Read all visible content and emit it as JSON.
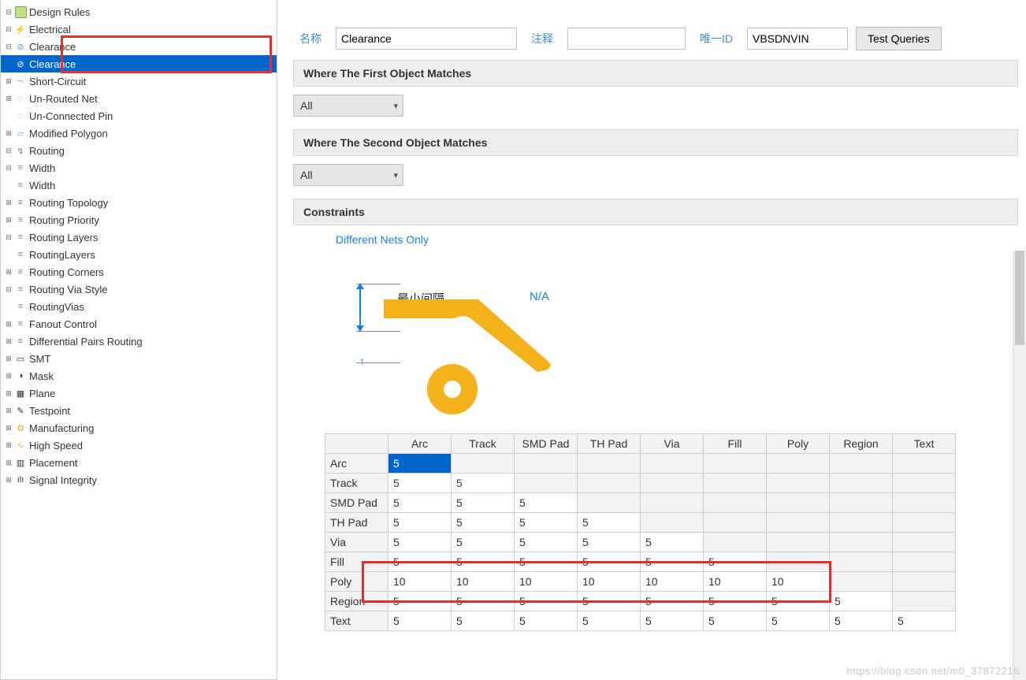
{
  "tree": {
    "root": "Design Rules",
    "electrical": {
      "label": "Electrical",
      "clearance": "Clearance",
      "clearance_child": "Clearance",
      "short_circuit": "Short-Circuit",
      "unrouted": "Un-Routed Net",
      "unconnected": "Un-Connected Pin",
      "modified_polygon": "Modified Polygon"
    },
    "routing": {
      "label": "Routing",
      "width": "Width",
      "width_child": "Width",
      "topology": "Routing Topology",
      "priority": "Routing Priority",
      "layers": "Routing Layers",
      "layers_child": "RoutingLayers",
      "corners": "Routing Corners",
      "via_style": "Routing Via Style",
      "via_child": "RoutingVias",
      "fanout": "Fanout Control",
      "diffpair": "Differential Pairs Routing"
    },
    "smt": "SMT",
    "mask": "Mask",
    "plane": "Plane",
    "testpoint": "Testpoint",
    "manufacturing": "Manufacturing",
    "highspeed": "High Speed",
    "placement": "Placement",
    "signal_integrity": "Signal Integrity"
  },
  "form": {
    "name_label": "名称",
    "name_value": "Clearance",
    "comment_label": "注释",
    "comment_value": "",
    "id_label": "唯一ID",
    "id_value": "VBSDNVIN",
    "test_btn": "Test Queries"
  },
  "sections": {
    "first_match": "Where The First Object Matches",
    "second_match": "Where The Second Object Matches",
    "first_value": "All",
    "second_value": "All",
    "constraints": "Constraints"
  },
  "constraints": {
    "diff_nets": "Different Nets Only",
    "min_gap": "最小间隔",
    "na": "N/A"
  },
  "matrix": {
    "cols": [
      "Arc",
      "Track",
      "SMD Pad",
      "TH Pad",
      "Via",
      "Fill",
      "Poly",
      "Region",
      "Text"
    ],
    "rows": [
      {
        "h": "Arc",
        "v": [
          "5"
        ]
      },
      {
        "h": "Track",
        "v": [
          "5",
          "5"
        ]
      },
      {
        "h": "SMD Pad",
        "v": [
          "5",
          "5",
          "5"
        ]
      },
      {
        "h": "TH Pad",
        "v": [
          "5",
          "5",
          "5",
          "5"
        ]
      },
      {
        "h": "Via",
        "v": [
          "5",
          "5",
          "5",
          "5",
          "5"
        ]
      },
      {
        "h": "Fill",
        "v": [
          "5",
          "5",
          "5",
          "5",
          "5",
          "5"
        ]
      },
      {
        "h": "Poly",
        "v": [
          "10",
          "10",
          "10",
          "10",
          "10",
          "10",
          "10"
        ]
      },
      {
        "h": "Region",
        "v": [
          "5",
          "5",
          "5",
          "5",
          "5",
          "5",
          "5",
          "5"
        ]
      },
      {
        "h": "Text",
        "v": [
          "5",
          "5",
          "5",
          "5",
          "5",
          "5",
          "5",
          "5",
          "5"
        ]
      }
    ]
  },
  "watermark": "https://blog.csdn.net/m0_37872216"
}
